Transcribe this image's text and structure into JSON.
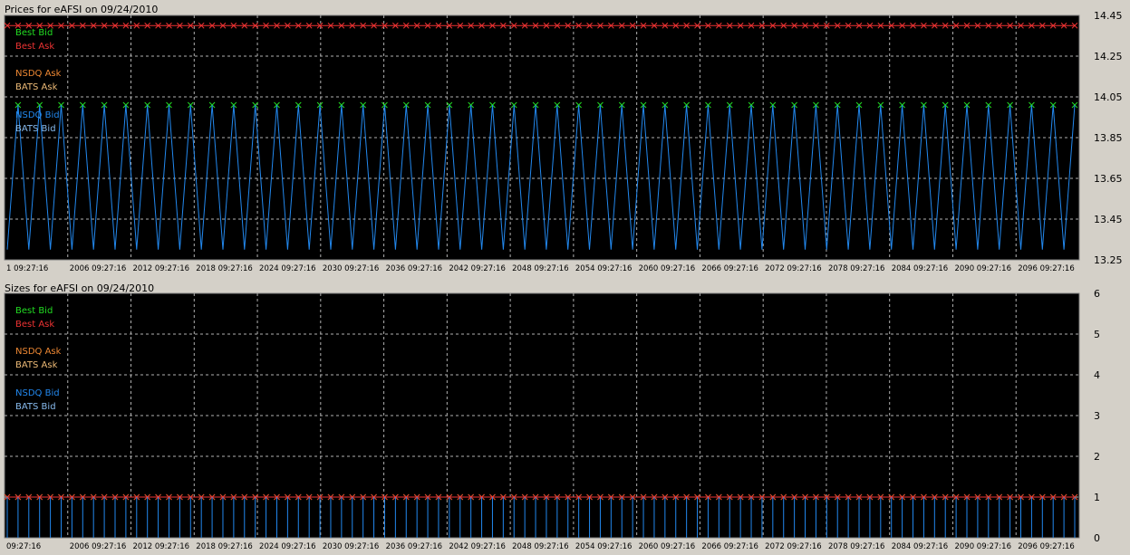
{
  "prices_title": "Prices for  eAFSI  on  09/24/2010",
  "sizes_title": "Sizes for  eAFSI  on  09/24/2010",
  "legend": [
    {
      "label": "Best Bid",
      "color": "#22dd22"
    },
    {
      "label": "Best Ask",
      "color": "#ee3333"
    },
    {
      "label": "NSDQ Ask",
      "color": "#ee8833"
    },
    {
      "label": "BATS Ask",
      "color": "#eebb77"
    },
    {
      "label": "NSDQ Bid",
      "color": "#2288ee"
    },
    {
      "label": "BATS Bid",
      "color": "#88bbee"
    }
  ],
  "x_tick_labels": [
    "1 09:27:16",
    "2006 09:27:16",
    "2012 09:27:16",
    "2018 09:27:16",
    "2024 09:27:16",
    "2030 09:27:16",
    "2036 09:27:16",
    "2042 09:27:16",
    "2048 09:27:16",
    "2054 09:27:16",
    "2060 09:27:16",
    "2066 09:27:16",
    "2072 09:27:16",
    "2078 09:27:16",
    "2084 09:27:16",
    "2090 09:27:16",
    "2096 09:27:16"
  ],
  "x_tick_labels_sizes": [
    "09:27:16",
    "2006 09:27:16",
    "2012 09:27:16",
    "2018 09:27:16",
    "2024 09:27:16",
    "2030 09:27:16",
    "2036 09:27:16",
    "2042 09:27:16",
    "2048 09:27:16",
    "2054 09:27:16",
    "2060 09:27:16",
    "2066 09:27:16",
    "2072 09:27:16",
    "2078 09:27:16",
    "2084 09:27:16",
    "2090 09:27:16",
    "2096 09:27:16"
  ],
  "chart_data": [
    {
      "type": "line",
      "title": "Prices for  eAFSI  on  09/24/2010",
      "y_ticks": [
        "14.45",
        "14.25",
        "14.05",
        "13.85",
        "13.65",
        "13.45",
        "13.25"
      ],
      "ylim": [
        13.25,
        14.45
      ],
      "grid": true,
      "legend_position": "top-left",
      "point_count": 100,
      "series": [
        {
          "name": "Best Ask",
          "pattern": "constant",
          "value": 14.4,
          "color": "#ee3333",
          "marker": "x"
        },
        {
          "name": "Best Bid",
          "pattern": "constant_at_peaks",
          "value": 14.01,
          "color": "#22dd22",
          "marker": "x"
        },
        {
          "name": "NSDQ Bid",
          "pattern": "oscillating",
          "values_cycle": [
            13.3,
            14.01
          ],
          "color": "#2288ee"
        }
      ]
    },
    {
      "type": "line",
      "title": "Sizes for  eAFSI  on  09/24/2010",
      "y_ticks": [
        "6",
        "5",
        "4",
        "3",
        "2",
        "1",
        "0"
      ],
      "ylim": [
        0,
        6
      ],
      "grid": true,
      "legend_position": "top-left",
      "point_count": 100,
      "series": [
        {
          "name": "Best Bid",
          "pattern": "constant",
          "value": 1,
          "color": "#22dd22",
          "marker": "x"
        },
        {
          "name": "Best Ask",
          "pattern": "constant",
          "value": 1,
          "color": "#ee3333",
          "marker": "x"
        },
        {
          "name": "NSDQ Bid",
          "pattern": "spikes",
          "value": 1,
          "color": "#2288ee"
        }
      ]
    }
  ]
}
